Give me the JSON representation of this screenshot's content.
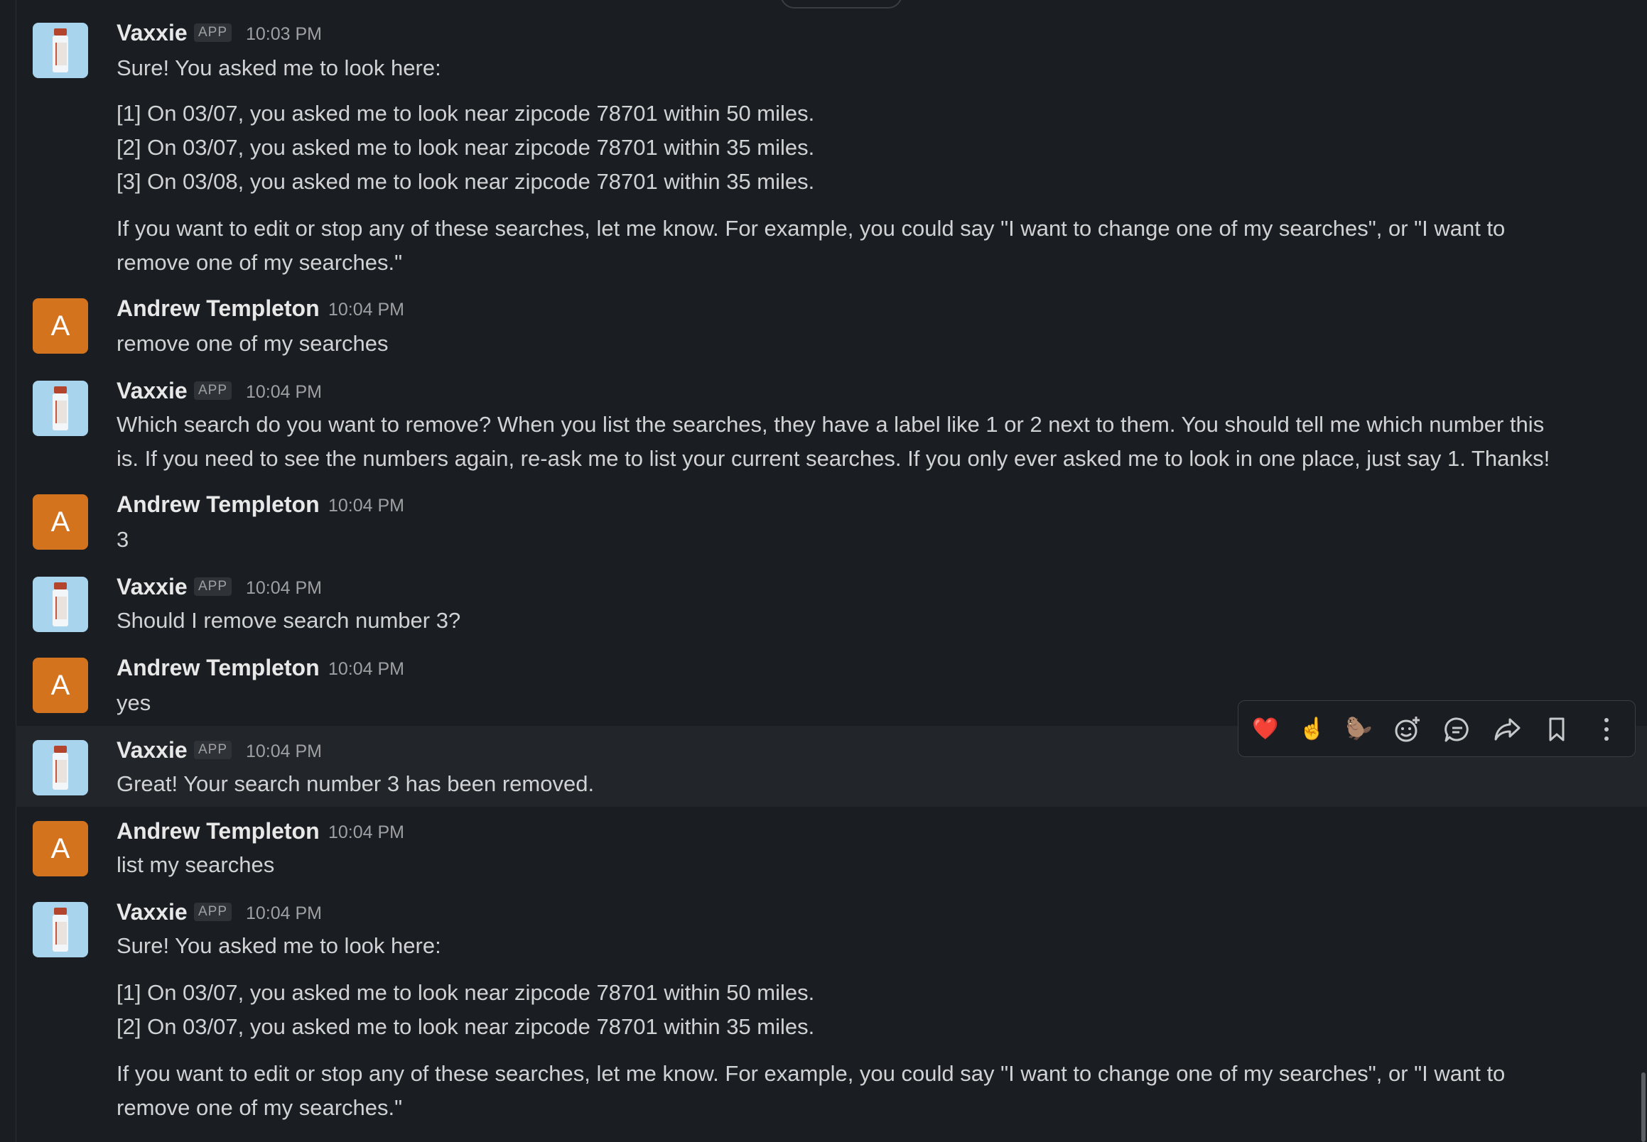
{
  "messages": [
    {
      "sender": "Vaxxie",
      "badge": "APP",
      "time": "10:03 PM",
      "lines": [
        "Sure! You asked me to look here:",
        "[1] On 03/07, you asked me to look near zipcode 78701 within 50 miles.",
        "[2] On 03/07, you asked me to look near zipcode 78701 within 35 miles.",
        "[3] On 03/08, you asked me to look near zipcode 78701 within 35 miles.",
        "If you want to edit or stop any of these searches, let me know. For example, you could say \"I want to change one of my searches\", or \"I want to",
        "remove one of my searches.\""
      ]
    },
    {
      "sender": "Andrew Templeton",
      "avatar_letter": "A",
      "time": "10:04 PM",
      "lines": [
        "remove one of my searches"
      ]
    },
    {
      "sender": "Vaxxie",
      "badge": "APP",
      "time": "10:04 PM",
      "lines": [
        "Which search do you want to remove? When you list the searches, they have a label like 1 or 2 next to them. You should tell me which number this",
        "is. If you need to see the numbers again, re-ask me to list your current searches. If you only ever asked me to look in one place, just say 1. Thanks!"
      ]
    },
    {
      "sender": "Andrew Templeton",
      "avatar_letter": "A",
      "time": "10:04 PM",
      "lines": [
        "3"
      ]
    },
    {
      "sender": "Vaxxie",
      "badge": "APP",
      "time": "10:04 PM",
      "lines": [
        "Should I remove search number 3?"
      ]
    },
    {
      "sender": "Andrew Templeton",
      "avatar_letter": "A",
      "time": "10:04 PM",
      "lines": [
        "yes"
      ]
    },
    {
      "sender": "Vaxxie",
      "badge": "APP",
      "time": "10:04 PM",
      "lines": [
        "Great! Your search number 3 has been removed."
      ]
    },
    {
      "sender": "Andrew Templeton",
      "avatar_letter": "A",
      "time": "10:04 PM",
      "lines": [
        "list my searches"
      ]
    },
    {
      "sender": "Vaxxie",
      "badge": "APP",
      "time": "10:04 PM",
      "lines": [
        "Sure! You asked me to look here:",
        "[1] On 03/07, you asked me to look near zipcode 78701 within 50 miles.",
        "[2] On 03/07, you asked me to look near zipcode 78701 within 35 miles.",
        "If you want to edit or stop any of these searches, let me know. For example, you could say \"I want to change one of my searches\", or \"I want to",
        "remove one of my searches.\""
      ]
    }
  ],
  "toolbar": {
    "icons": [
      "heart-emoji",
      "point-up-emoji",
      "beaver-emoji",
      "add-reaction-icon",
      "reply-thread-icon",
      "share-icon",
      "bookmark-icon",
      "more-actions-icon"
    ],
    "heart": "❤️",
    "point_up": "☝️",
    "beaver": "🦫"
  },
  "colors": {
    "background": "#1a1d21",
    "hover_row": "#222529",
    "user_avatar": "#d4731e",
    "bot_avatar": "#a8d4ee"
  }
}
